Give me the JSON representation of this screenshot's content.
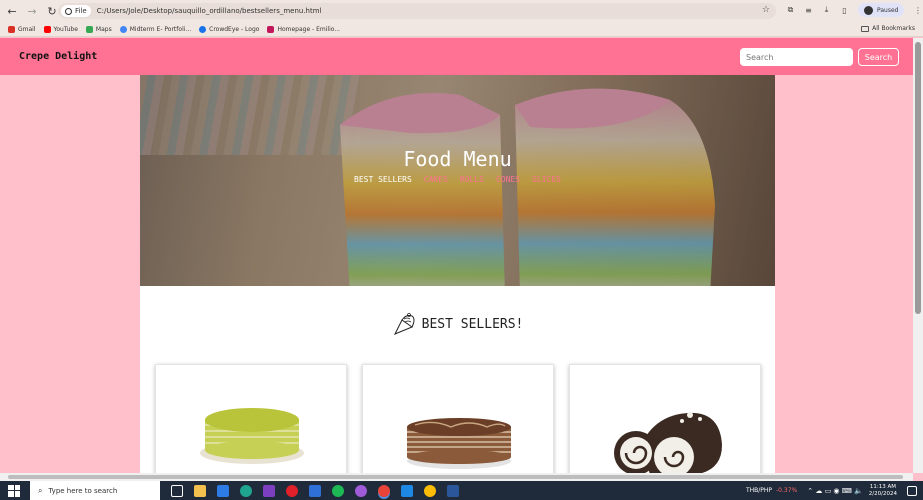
{
  "browser": {
    "file_chip": "File",
    "url": "C:/Users/Jole/Desktop/sauquillo_ordillano/bestsellers_menu.html",
    "profile_status": "Paused",
    "bookmarks": [
      {
        "label": "Gmail",
        "icon": "gmail-icon",
        "color": "#d93025"
      },
      {
        "label": "YouTube",
        "icon": "youtube-icon",
        "color": "#ff0000"
      },
      {
        "label": "Maps",
        "icon": "maps-icon",
        "color": "#34a853"
      },
      {
        "label": "Midterm E- Portfoli...",
        "icon": "site-icon",
        "color": "#4285f4"
      },
      {
        "label": "CrowdEye - Logo",
        "icon": "site-icon",
        "color": "#1a73e8"
      },
      {
        "label": "Homepage - Emilio...",
        "icon": "site-icon",
        "color": "#c2185b"
      }
    ],
    "all_bookmarks": "All Bookmarks"
  },
  "header": {
    "brand": "Crepe Delight",
    "search_placeholder": "Search",
    "search_button": "Search",
    "bg_color": "#ff7293"
  },
  "hero": {
    "title": "Food Menu",
    "nav": [
      {
        "label": "BEST SELLERS",
        "active": true
      },
      {
        "label": "CAKES",
        "active": false
      },
      {
        "label": "ROLLS",
        "active": false
      },
      {
        "label": "CONES",
        "active": false
      },
      {
        "label": "SLICES",
        "active": false
      }
    ]
  },
  "section": {
    "title": "BEST SELLERS!",
    "icon": "crepe-cone-icon"
  },
  "cards": [
    {
      "name": "matcha-crepe-cake"
    },
    {
      "name": "chocolate-crepe-cake"
    },
    {
      "name": "cookies-cream-rolls"
    }
  ],
  "taskbar": {
    "search_placeholder": "Type here to search",
    "currency": "THB/PHP",
    "change": "-0.37%",
    "time": "11:13 AM",
    "date": "2/20/2024"
  }
}
